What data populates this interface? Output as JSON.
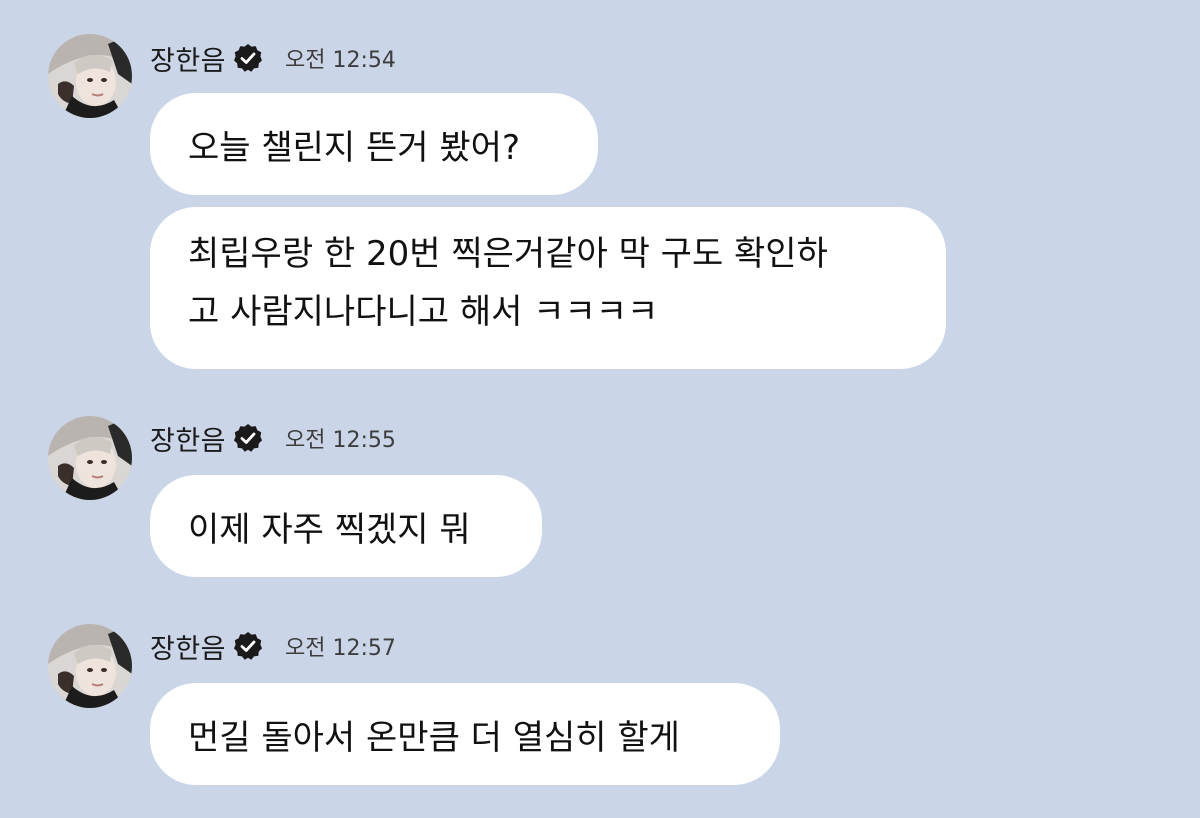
{
  "colors": {
    "background": "#cad5e8",
    "bubble": "#ffffff",
    "verified_badge": "#1a1a1a"
  },
  "groups": [
    {
      "sender": "장한음",
      "verified_icon": "verified-check-icon",
      "time": "오전 12:54",
      "messages": [
        {
          "lines": [
            "오늘 챌린지 뜬거 봤어?"
          ]
        },
        {
          "lines": [
            "최립우랑 한 20번 찍은거같아 막 구도 확인하",
            "고 사람지나다니고 해서 ㅋㅋㅋㅋ"
          ]
        }
      ]
    },
    {
      "sender": "장한음",
      "verified_icon": "verified-check-icon",
      "time": "오전 12:55",
      "messages": [
        {
          "lines": [
            "이제 자주 찍겠지 뭐"
          ]
        }
      ]
    },
    {
      "sender": "장한음",
      "verified_icon": "verified-check-icon",
      "time": "오전 12:57",
      "messages": [
        {
          "lines": [
            "먼길 돌아서 온만큼 더 열심히 할게"
          ]
        }
      ]
    }
  ]
}
